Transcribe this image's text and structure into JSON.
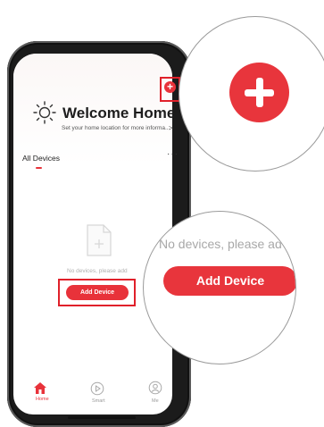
{
  "welcome": {
    "title": "Welcome Home",
    "subtitle": "Set your home location for more informa...",
    "arrow": ">"
  },
  "add_button": {
    "icon": "plus-icon",
    "label": "+"
  },
  "tabs": {
    "all_devices": "All Devices",
    "more": "···"
  },
  "empty_state": {
    "icon": "file-plus-icon",
    "text": "No devices, please add",
    "add_device_label": "Add Device"
  },
  "tabbar": [
    {
      "label": "Home",
      "icon": "home-icon",
      "active": true
    },
    {
      "label": "Smart",
      "icon": "smart-play-icon",
      "active": false
    },
    {
      "label": "Me",
      "icon": "profile-icon",
      "active": false
    }
  ],
  "zoom_bottom": {
    "text": "No devices, please ad",
    "add_device_label": "Add Device"
  },
  "colors": {
    "accent": "#e8323a",
    "highlight": "#e0202a"
  }
}
